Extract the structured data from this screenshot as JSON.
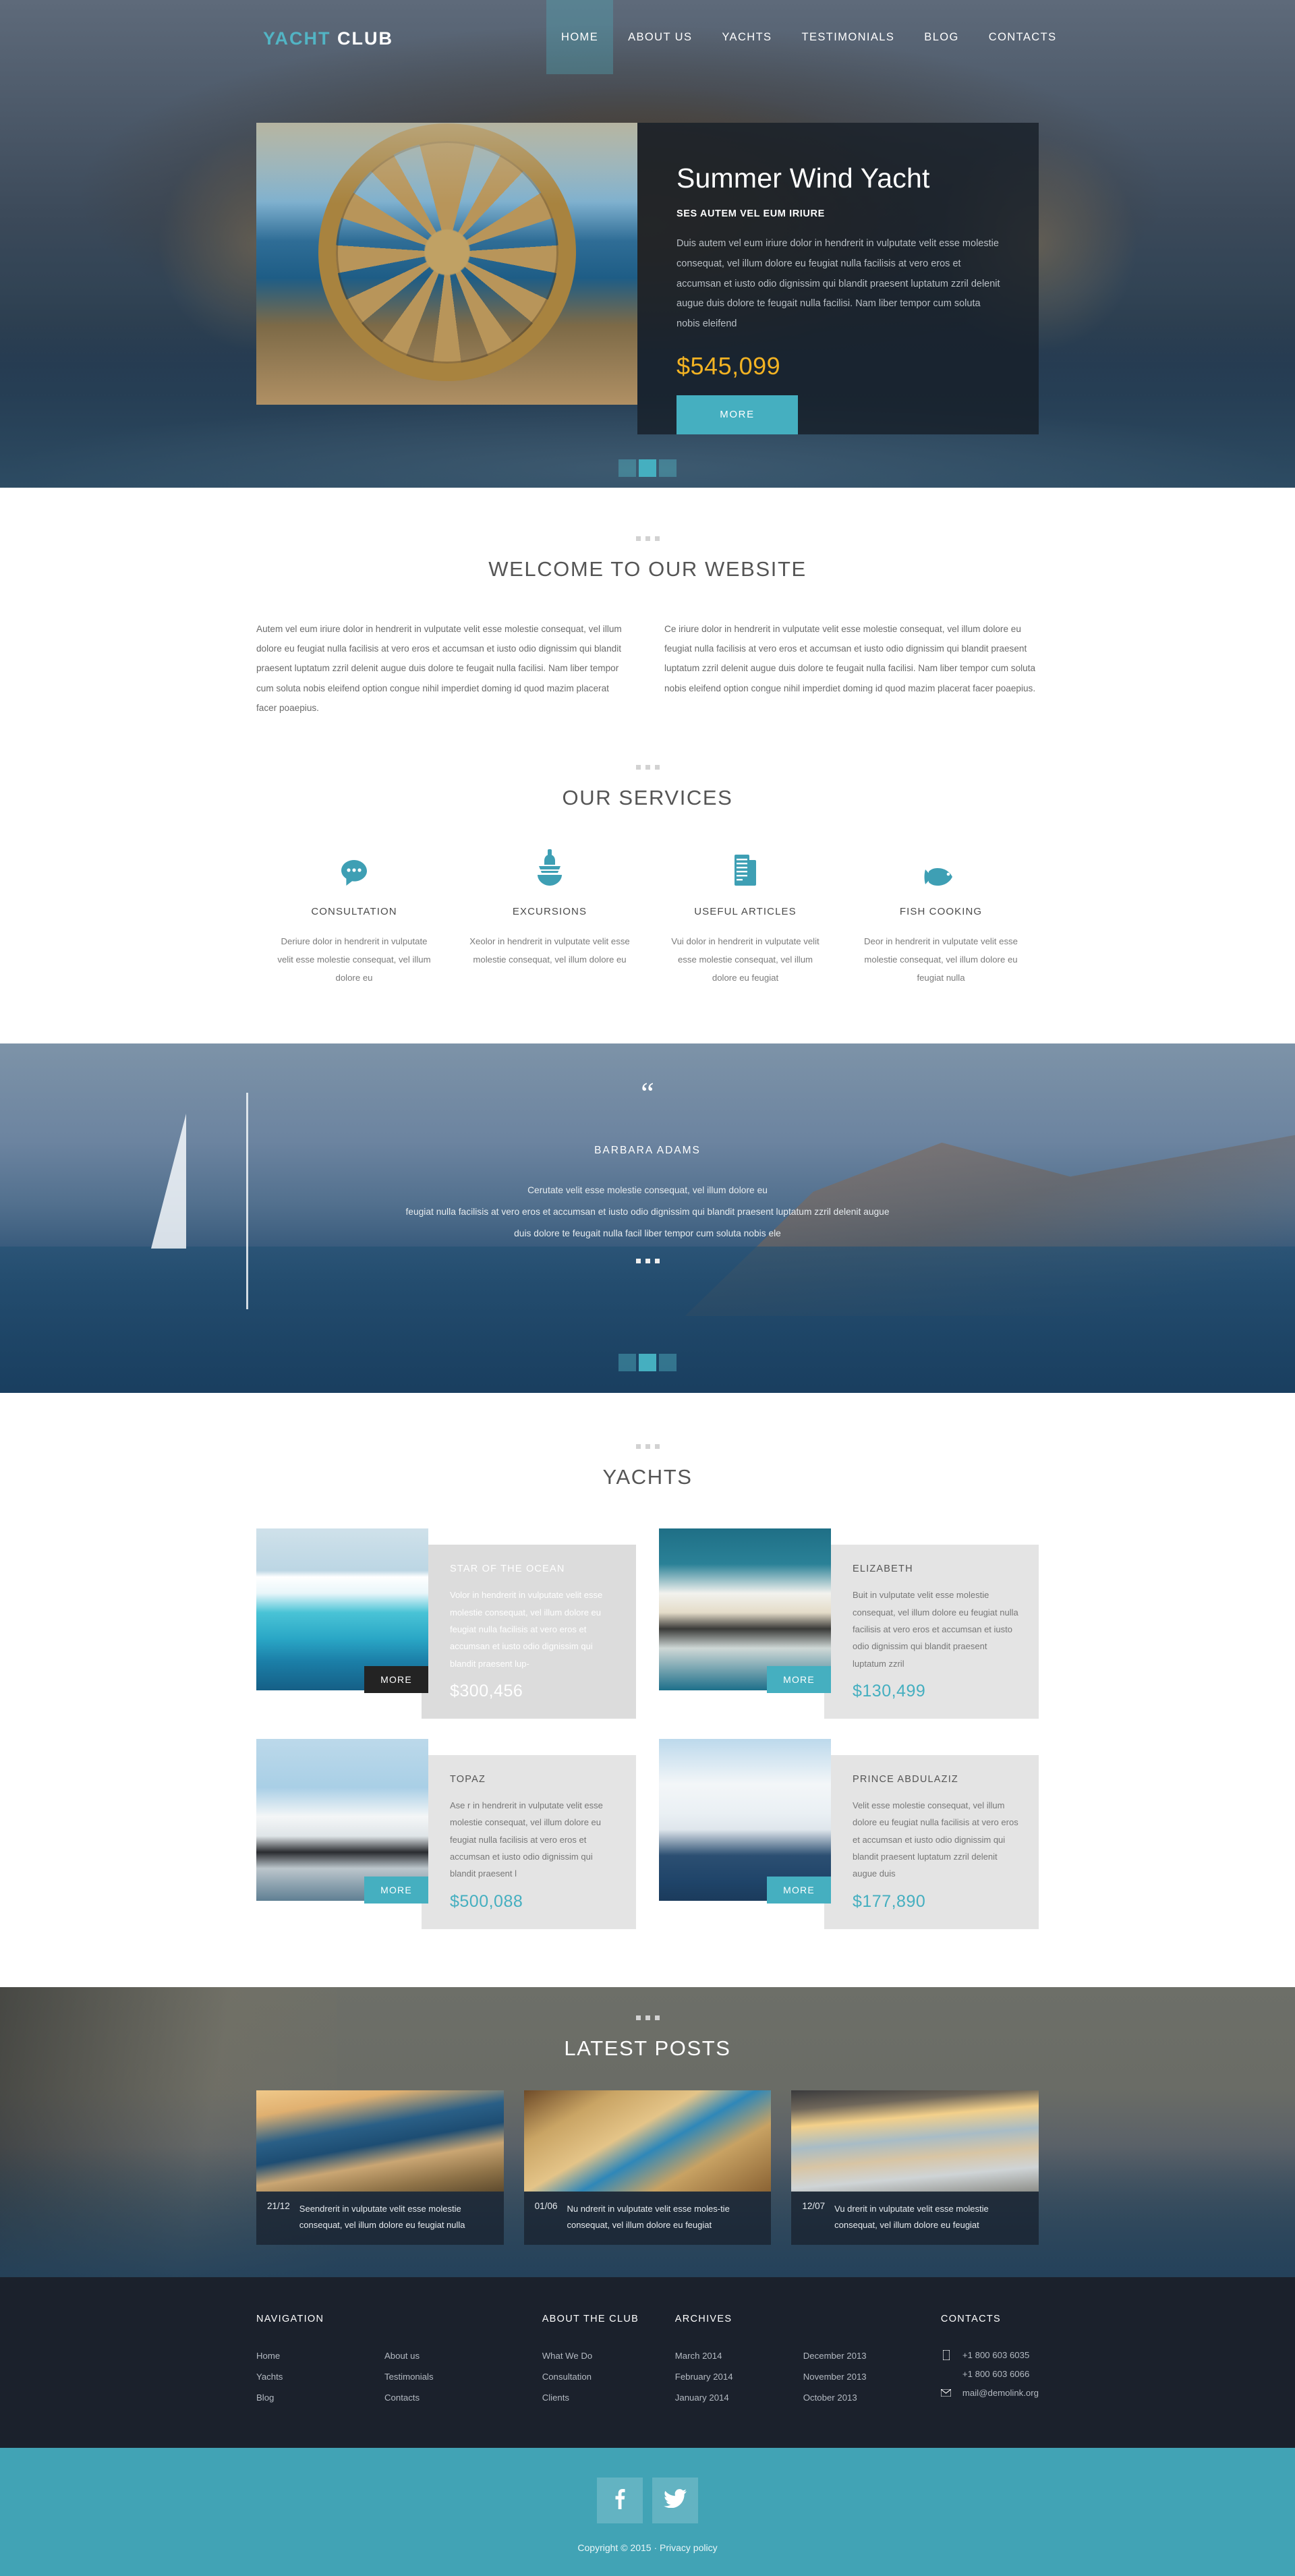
{
  "brand": {
    "part1": "YACHT",
    "part2": "CLUB",
    "accent": "#52b4c4"
  },
  "nav": [
    {
      "label": "HOME",
      "active": true
    },
    {
      "label": "ABOUT US",
      "active": false
    },
    {
      "label": "YACHTS",
      "active": false
    },
    {
      "label": "TESTIMONIALS",
      "active": false
    },
    {
      "label": "BLOG",
      "active": false
    },
    {
      "label": "CONTACTS",
      "active": false
    }
  ],
  "hero": {
    "title": "Summer Wind Yacht",
    "subtitle": "SES AUTEM VEL EUM IRIURE",
    "description": "Duis autem vel eum iriure dolor in hendrerit in vulputate velit esse molestie consequat, vel illum dolore eu feugiat nulla facilisis at vero eros et accumsan et iusto odio dignissim qui blandit praesent luptatum zzril delenit augue duis dolore te feugait nulla facilisi. Nam liber tempor cum soluta nobis eleifend",
    "price": "$545,099",
    "button": "MORE",
    "slides": 3,
    "active_slide": 2
  },
  "welcome": {
    "title": "WELCOME TO OUR WEBSITE",
    "col1": "Autem vel eum iriure dolor in hendrerit in vulputate velit esse molestie consequat, vel illum dolore eu feugiat nulla facilisis at vero eros et accumsan et iusto odio dignissim qui blandit praesent luptatum zzril delenit augue duis dolore te feugait nulla facilisi. Nam liber tempor cum soluta nobis eleifend option congue nihil imperdiet doming id quod mazim placerat facer poaepius.",
    "col2": "Ce iriure dolor in hendrerit in vulputate velit esse molestie consequat, vel illum dolore eu feugiat nulla facilisis at vero eros et accumsan et iusto odio dignissim qui blandit praesent luptatum zzril delenit augue duis dolore te feugait nulla facilisi. Nam liber tempor cum soluta nobis eleifend option congue nihil imperdiet doming id quod mazim placerat facer poaepius."
  },
  "services": {
    "title": "OUR SERVICES",
    "items": [
      {
        "icon": "speech-bubble-icon",
        "title": "CONSULTATION",
        "text": "Deriure dolor in hendrerit in vulputate velit esse molestie consequat, vel illum dolore eu"
      },
      {
        "icon": "boat-icon",
        "title": "EXCURSIONS",
        "text": "Xeolor in hendrerit in vulputate velit esse molestie consequat, vel illum dolore eu"
      },
      {
        "icon": "article-icon",
        "title": "USEFUL ARTICLES",
        "text": "Vui  dolor in hendrerit in vulputate velit esse molestie consequat, vel illum dolore eu feugiat"
      },
      {
        "icon": "fish-icon",
        "title": "FISH COOKING",
        "text": "Deor in hendrerit in vulputate velit esse molestie consequat, vel illum dolore eu feugiat nulla"
      }
    ]
  },
  "testimonial": {
    "quote_mark": "“",
    "author": "BARBARA ADAMS",
    "line1": "Cerutate velit esse molestie consequat, vel illum dolore eu",
    "line2": "feugiat nulla facilisis at vero eros et accumsan et iusto odio dignissim qui blandit praesent luptatum zzril delenit augue",
    "line3": "duis dolore te feugait nulla facil liber tempor cum soluta nobis ele",
    "slides": 3,
    "active_slide": 2
  },
  "yachts": {
    "title": "YACHTS",
    "more_label": "MORE",
    "items": [
      {
        "name": "STAR OF THE OCEAN",
        "text": "Volor in hendrerit in vulputate velit esse molestie consequat, vel illum dolore eu feugiat nulla facilisis at vero eros et accumsan et iusto odio dignissim qui blandit praesent lup-",
        "price": "$300,456",
        "hovered": true
      },
      {
        "name": "ELIZABETH",
        "text": "Buit in vulputate velit esse molestie consequat, vel illum dolore eu feugiat nulla facilisis at vero eros et accumsan et iusto odio dignissim qui blandit praesent luptatum zzril",
        "price": "$130,499",
        "hovered": false
      },
      {
        "name": "TOPAZ",
        "text": "Ase r in hendrerit in vulputate velit esse molestie consequat, vel illum dolore eu feugiat nulla facilisis at vero eros et accumsan et iusto odio dignissim qui blandit praesent l",
        "price": "$500,088",
        "hovered": false
      },
      {
        "name": "PRINCE ABDULAZIZ",
        "text": "Velit esse molestie consequat, vel illum dolore eu feugiat nulla facilisis at vero eros et accumsan et iusto odio dignissim qui blandit praesent luptatum zzril delenit augue duis",
        "price": "$177,890",
        "hovered": false
      }
    ]
  },
  "posts": {
    "title": "LATEST POSTS",
    "items": [
      {
        "date": "21/12",
        "text": "Seendrerit in vulputate velit esse molestie consequat, vel illum dolore eu feugiat nulla"
      },
      {
        "date": "01/06",
        "text": "Nu ndrerit in vulputate velit esse moles-tie consequat, vel illum dolore eu feugiat"
      },
      {
        "date": "12/07",
        "text": "Vu drerit in vulputate velit esse molestie consequat, vel illum dolore eu feugiat"
      }
    ]
  },
  "footer": {
    "navigation": {
      "heading": "NAVIGATION",
      "col1": [
        "Home",
        "Yachts",
        "Blog"
      ],
      "col2": [
        "About us",
        "Testimonials",
        "Contacts"
      ]
    },
    "about": {
      "heading": "ABOUT THE CLUB",
      "items": [
        "What We Do",
        "Consultation",
        "Clients"
      ]
    },
    "archives": {
      "heading": "ARCHIVES",
      "col1": [
        "March 2014",
        "February 2014",
        "January 2014"
      ],
      "col2": [
        "December 2013",
        "November 2013",
        "October 2013"
      ]
    },
    "contacts": {
      "heading": "CONTACTS",
      "phone1": "+1 800 603 6035",
      "phone2": "+1 800 603 6066",
      "email": "mail@demolink.org"
    }
  },
  "social": {
    "facebook": "facebook-icon",
    "twitter": "twitter-icon",
    "copyright": "Copyright © 2015 · Privacy policy",
    "bar_color": "#41a3b5"
  }
}
